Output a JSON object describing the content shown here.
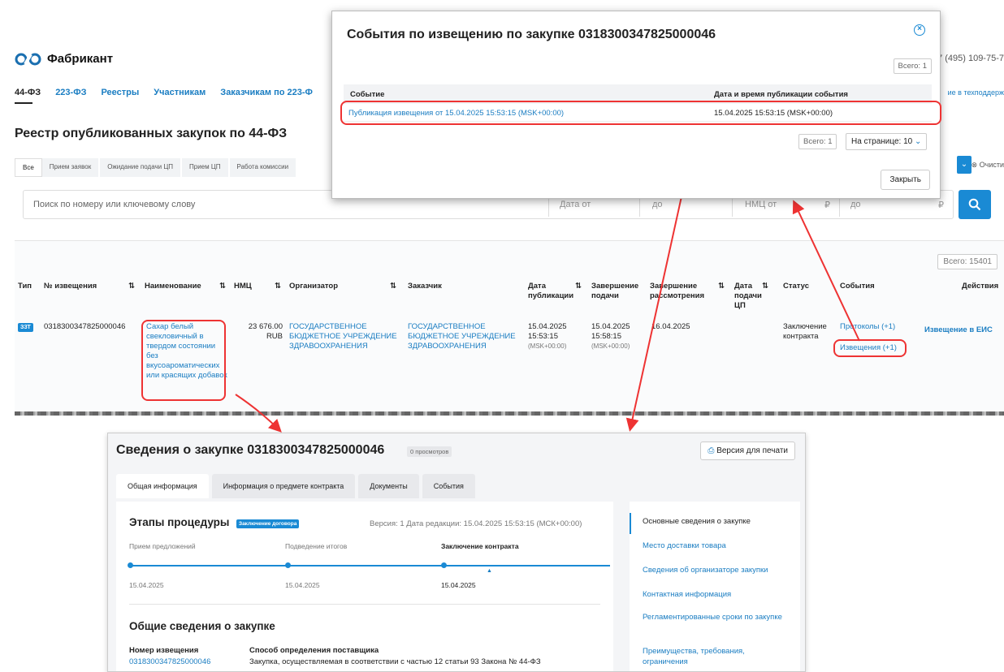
{
  "bg": {
    "logo": "Фабрикант",
    "phone": "7 (495) 109-75-7",
    "nav": [
      "44-ФЗ",
      "223-ФЗ",
      "Реестры",
      "Участникам",
      "Заказчикам по 223-Ф"
    ],
    "support": "ие в техподдерж",
    "title": "Реестр опубликованных закупок по 44-ФЗ",
    "filter_tabs": [
      "Все",
      "Прием заявок",
      "Ожидание подачи ЦП",
      "Прием ЦП",
      "Работа комиссии"
    ],
    "clear": "Очисти",
    "search_placeholder": "Поиск по номеру или ключевому слову",
    "date_from": "Дата от",
    "date_to": "до",
    "nmc_from": "НМЦ от",
    "nmc_to": "до",
    "ruble": "₽",
    "total": "Всего: 15401",
    "columns": {
      "type": "Тип",
      "number": "№ извещения",
      "name": "Наименование",
      "nmc": "НМЦ",
      "organizer": "Организатор",
      "customer": "Заказчик",
      "pub_date": "Дата публикации",
      "end_submit": "Завершение подачи",
      "end_review": "Завершение рассмотрения",
      "price_date": "Дата подачи ЦП",
      "status": "Статус",
      "events": "События",
      "actions": "Действия"
    },
    "row": {
      "type": "ЗЗТ",
      "number": "0318300347825000046",
      "name": "Сахар белый свекловичный в твердом состоянии без вкусоароматических или красящих добавок",
      "nmc": "23 676.00",
      "currency": "RUB",
      "organizer": "ГОСУДАРСТВЕННОЕ БЮДЖЕТНОЕ УЧРЕЖДЕНИЕ ЗДРАВООХРАНЕНИЯ",
      "customer": "ГОСУДАРСТВЕННОЕ БЮДЖЕТНОЕ УЧРЕЖДЕНИЕ ЗДРАВООХРАНЕНИЯ",
      "pub_date": "15.04.2025",
      "pub_time": "15:53:15",
      "tz": "(MSK+00:00)",
      "end_date": "15.04.2025",
      "end_time": "15:58:15",
      "review": "16.04.2025",
      "status": "Заключение контракта",
      "protocols": "Протоколы (+1)",
      "notices": "Извещения (+1)",
      "action": "Извещение в ЕИС"
    }
  },
  "modal": {
    "title": "События по извещению по закупке 0318300347825000046",
    "total": "Всего: 1",
    "col_event": "Событие",
    "col_datetime": "Дата и время публикации события",
    "event": "Публикация извещения от 15.04.2025 15:53:15 (MSK+00:00)",
    "event_datetime": "15.04.2025 15:53:15 (MSK+00:00)",
    "total2": "Всего: 1",
    "per_page": "На странице: 10",
    "close": "Закрыть"
  },
  "card": {
    "title": "Сведения о закупке 0318300347825000046",
    "views": "0 просмотров",
    "print": "Версия для печати",
    "tabs": [
      "Общая информация",
      "Информация о предмете контракта",
      "Документы",
      "События"
    ],
    "stages_title": "Этапы процедуры",
    "stage_tag": "Заключение договора",
    "version": "Версия: 1 Дата редакции: 15.04.2025 15:53:15 (МСК+00:00)",
    "stages": [
      "Прием предложений",
      "Подведение итогов",
      "Заключение контракта"
    ],
    "stage_dates": [
      "15.04.2025",
      "15.04.2025",
      "15.04.2025"
    ],
    "general_title": "Общие сведения о закупке",
    "num_label": "Номер извещения",
    "num_value": "0318300347825000046",
    "method_label": "Способ определения поставщика",
    "method_value": "Закупка, осуществляемая в соответствии с частью 12 статьи 93 Закона № 44-ФЗ",
    "side": [
      "Основные сведения о закупке",
      "Место доставки товара",
      "Сведения об организаторе закупки",
      "Контактная информация",
      "Регламентированные сроки по закупке",
      "Преимущества, требования, ограничения"
    ]
  }
}
